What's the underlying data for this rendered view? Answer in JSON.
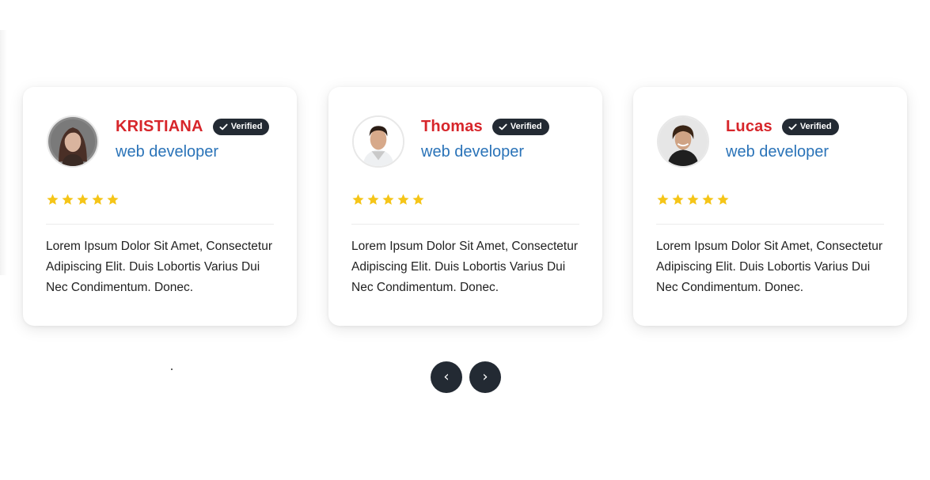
{
  "testimonials": [
    {
      "name": "KRISTIANA",
      "badge": "Verified",
      "role": "web developer",
      "rating": 5,
      "text": "Lorem Ipsum Dolor Sit Amet, Consectetur Adipiscing Elit. Duis Lobortis Varius Dui Nec Condimentum. Donec."
    },
    {
      "name": "Thomas",
      "badge": "Verified",
      "role": "web developer",
      "rating": 5,
      "text": "Lorem Ipsum Dolor Sit Amet, Consectetur Adipiscing Elit. Duis Lobortis Varius Dui Nec Condimentum. Donec."
    },
    {
      "name": "Lucas",
      "badge": "Verified",
      "role": "web developer",
      "rating": 5,
      "text": "Lorem Ipsum Dolor Sit Amet, Consectetur Adipiscing Elit. Duis Lobortis Varius Dui Nec Condimentum. Donec."
    }
  ],
  "navigation": {
    "prev_label": "‹",
    "next_label": "›"
  },
  "colors": {
    "name": "#d7262b",
    "role": "#2a73b8",
    "badge_bg": "#232a33",
    "star": "#f5c518",
    "nav_bg": "#232a33"
  },
  "icons": {
    "badge": "check-icon",
    "rating": "star-icon",
    "prev": "chevron-left-icon",
    "next": "chevron-right-icon"
  }
}
